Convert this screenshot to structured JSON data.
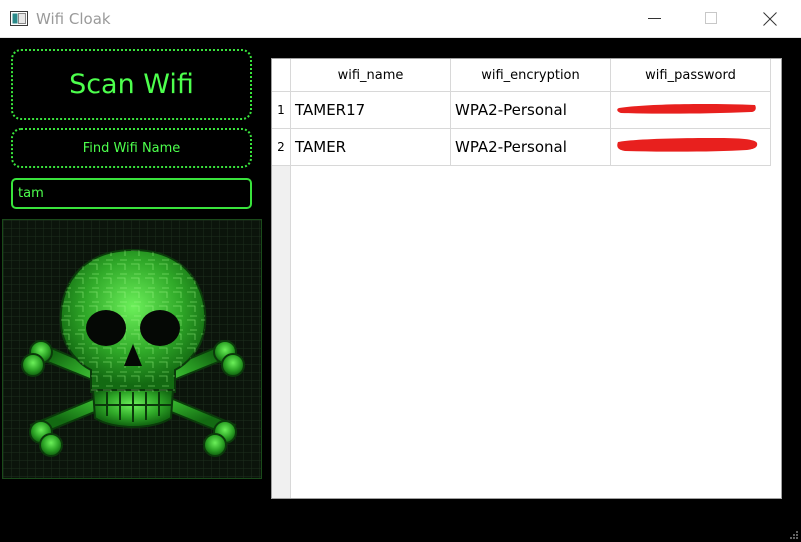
{
  "window": {
    "title": "Wifi Cloak",
    "controls": [
      "minimize",
      "maximize",
      "close"
    ]
  },
  "left_panel": {
    "scan_button_label": "Scan Wifi",
    "find_button_label": "Find Wifi Name",
    "search_value": "tam",
    "search_placeholder": "",
    "image": "skull-and-crossbones-icon",
    "accent_color": "#39e33c"
  },
  "table": {
    "columns": [
      "wifi_name",
      "wifi_encryption",
      "wifi_password"
    ],
    "rows": [
      {
        "num": "1",
        "wifi_name": "TAMER17",
        "wifi_encryption": "WPA2-Personal",
        "wifi_password": ""
      },
      {
        "num": "2",
        "wifi_name": "TAMER",
        "wifi_encryption": "WPA2-Personal",
        "wifi_password": ""
      }
    ],
    "redaction_color": "#e8201e"
  }
}
